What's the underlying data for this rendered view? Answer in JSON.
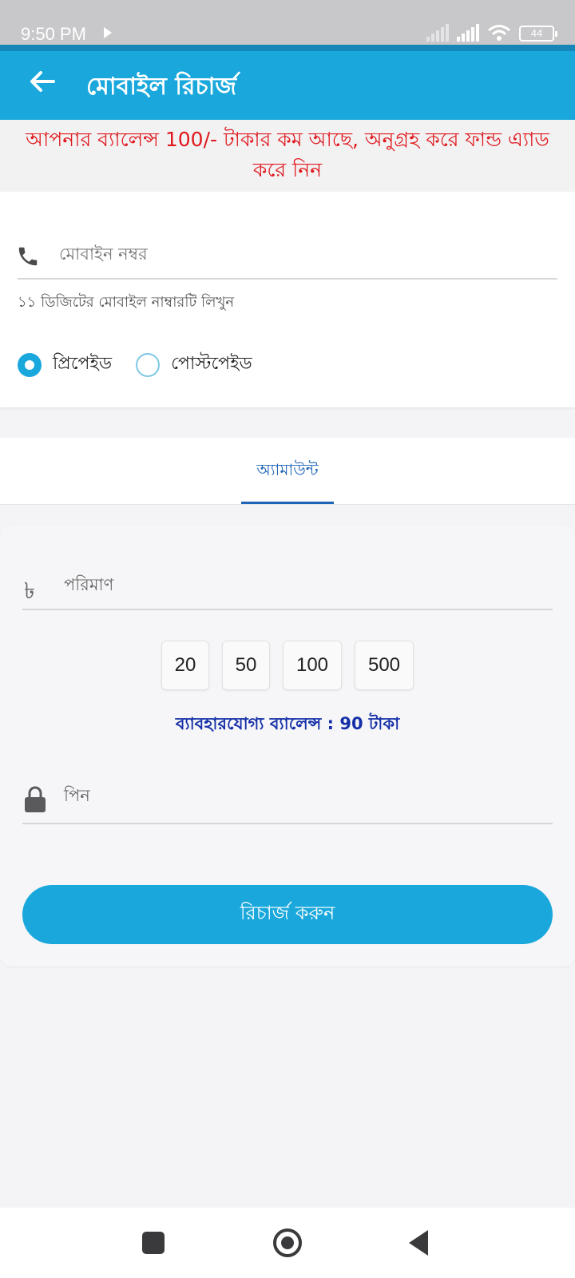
{
  "status_bar": {
    "time": "9:50 PM",
    "battery": "44"
  },
  "header": {
    "title": "মোবাইল রিচার্জ"
  },
  "warning": {
    "text": "আপনার ব্যালেন্স 100/- টাকার কম আছে, অনুগ্রহ করে ফান্ড এ্যাড করে নিন"
  },
  "mobile": {
    "placeholder": "মোবাইন নম্বর",
    "hint": "১১ ডিজিটের মোবাইল নাম্বারটি লিখুন",
    "options": [
      {
        "label": "প্রিপেইড",
        "selected": true
      },
      {
        "label": "পোস্টপেইড",
        "selected": false
      }
    ]
  },
  "tabs": {
    "amount": "অ্যামাউন্ট"
  },
  "amount": {
    "currency_symbol": "৳",
    "placeholder": "পরিমাণ",
    "quick_amounts": [
      "20",
      "50",
      "100",
      "500"
    ],
    "balance_text": "ব্যাবহারযোগ্য ব্যালেন্স : 90 টাকা"
  },
  "pin": {
    "placeholder": "পিন"
  },
  "actions": {
    "recharge": "রিচার্জ করুন"
  },
  "colors": {
    "primary": "#1aa8dc",
    "warning": "#e0191e",
    "balance": "#1530a8",
    "tab_active": "#1e63b6"
  },
  "icons": [
    "back-arrow-icon",
    "phone-icon",
    "taka-icon",
    "lock-icon"
  ]
}
